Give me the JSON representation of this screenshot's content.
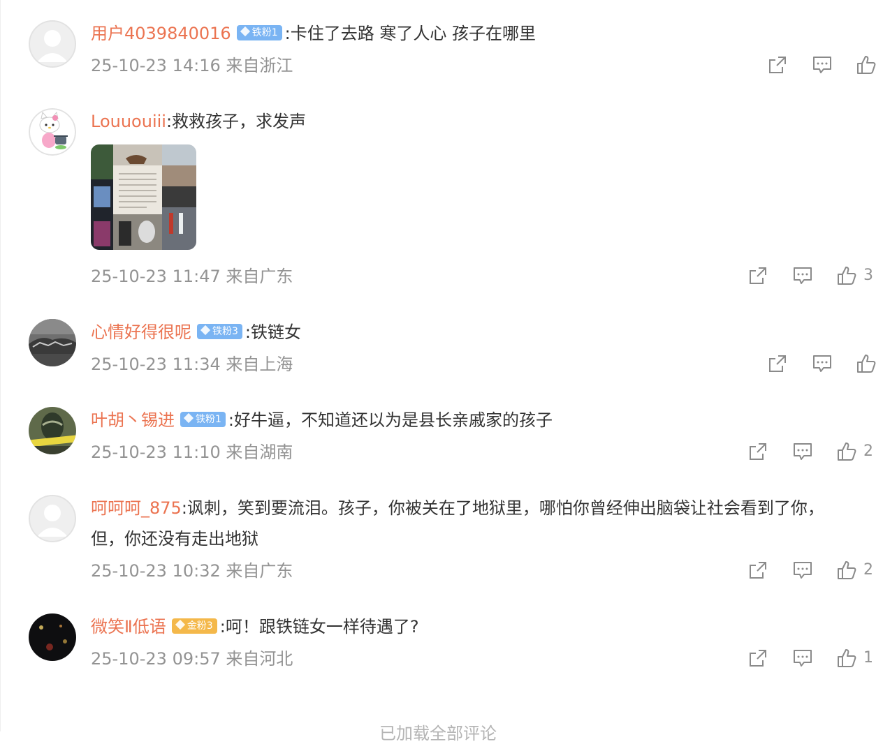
{
  "comments": [
    {
      "user": "用户4039840016",
      "badge": {
        "label": "铁粉1",
        "tier": "iron"
      },
      "text": "卡住了去路 寒了人心  孩子在哪里",
      "meta": "25-10-23 14:16 来自浙江",
      "likes": ""
    },
    {
      "user": "Louuouiii",
      "badge": null,
      "text": "救救孩子，求发声",
      "meta": "25-10-23 11:47 来自广东",
      "likes": "3"
    },
    {
      "user": "心情好得很呢",
      "badge": {
        "label": "铁粉3",
        "tier": "iron"
      },
      "text": "铁链女",
      "meta": "25-10-23 11:34 来自上海",
      "likes": ""
    },
    {
      "user": "叶胡丶锡进",
      "badge": {
        "label": "铁粉1",
        "tier": "iron"
      },
      "text": "好牛逼，不知道还以为是县长亲戚家的孩子",
      "meta": "25-10-23 11:10 来自湖南",
      "likes": "2"
    },
    {
      "user": "呵呵呵_875",
      "badge": null,
      "text": "讽刺，笑到要流泪。孩子，你被关在了地狱里，哪怕你曾经伸出脑袋让社会看到了你，但，你还没有走出地狱",
      "meta": "25-10-23 10:32 来自广东",
      "likes": "2"
    },
    {
      "user": "微笑Ⅱ低语",
      "badge": {
        "label": "金粉3",
        "tier": "gold"
      },
      "text": "呵！跟铁链女一样待遇了?",
      "meta": "25-10-23 09:57 来自河北",
      "likes": "1"
    }
  ],
  "load_more": "已加载全部评论",
  "colors": {
    "username": "#eb7350",
    "meta": "#939393",
    "iron_badge": "#7ab4f3",
    "gold_badge": "#f4b84a"
  },
  "icons": [
    "share-icon",
    "comment-icon",
    "like-icon"
  ]
}
